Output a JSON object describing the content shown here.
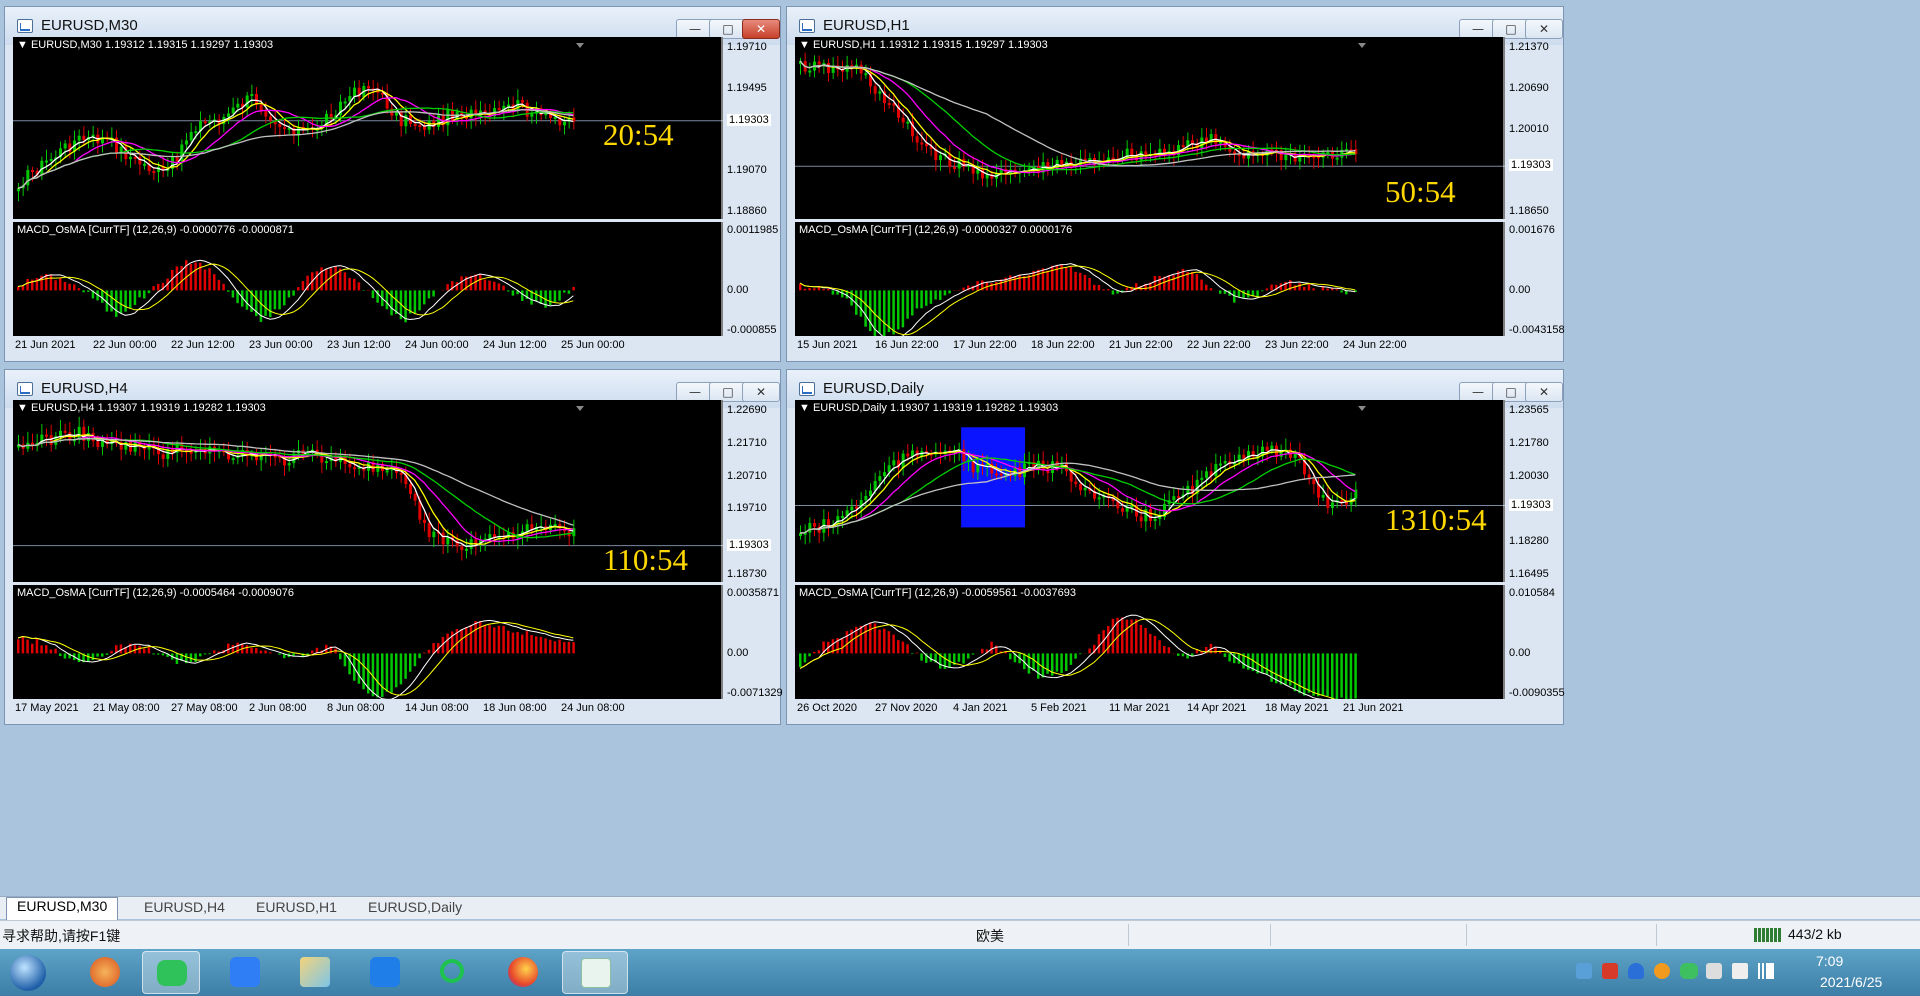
{
  "windows": [
    {
      "title": "EURUSD,M30",
      "symbol_line": "EURUSD,M30  1.19312 1.19315 1.19297 1.19303",
      "indicator_line": "MACD_OsMA [CurrTF] (12,26,9) -0.0000776 -0.0000871",
      "price_axis": [
        "1.19710",
        "1.19495",
        "1.19303",
        "1.19070",
        "1.18860"
      ],
      "ind_axis": [
        "0.0011985",
        "0.00",
        "-0.000855"
      ],
      "time_axis": [
        "21 Jun 2021",
        "22 Jun 00:00",
        "22 Jun 12:00",
        "23 Jun 00:00",
        "23 Jun 12:00",
        "24 Jun 00:00",
        "24 Jun 12:00",
        "25 Jun 00:00"
      ],
      "current_price": "1.19303",
      "countdown": "20:54"
    },
    {
      "title": "EURUSD,H1",
      "symbol_line": "EURUSD,H1  1.19312 1.19315 1.19297 1.19303",
      "indicator_line": "MACD_OsMA [CurrTF] (12,26,9) -0.0000327 0.0000176",
      "price_axis": [
        "1.21370",
        "1.20690",
        "1.20010",
        "1.19303",
        "1.18650"
      ],
      "ind_axis": [
        "0.001676",
        "0.00",
        "-0.0043158"
      ],
      "time_axis": [
        "15 Jun 2021",
        "16 Jun 22:00",
        "17 Jun 22:00",
        "18 Jun 22:00",
        "21 Jun 22:00",
        "22 Jun 22:00",
        "23 Jun 22:00",
        "24 Jun 22:00"
      ],
      "current_price": "1.19303",
      "countdown": "50:54"
    },
    {
      "title": "EURUSD,H4",
      "symbol_line": "EURUSD,H4  1.19307 1.19319 1.19282 1.19303",
      "indicator_line": "MACD_OsMA [CurrTF] (12,26,9) -0.0005464 -0.0009076",
      "price_axis": [
        "1.22690",
        "1.21710",
        "1.20710",
        "1.19710",
        "1.19303",
        "1.18730"
      ],
      "ind_axis": [
        "0.0035871",
        "0.00",
        "-0.0071329"
      ],
      "time_axis": [
        "17 May 2021",
        "21 May 08:00",
        "27 May 08:00",
        "2 Jun 08:00",
        "8 Jun 08:00",
        "14 Jun 08:00",
        "18 Jun 08:00",
        "24 Jun 08:00"
      ],
      "current_price": "1.19303",
      "countdown": "110:54"
    },
    {
      "title": "EURUSD,Daily",
      "symbol_line": "EURUSD,Daily  1.19307 1.19319 1.19282 1.19303",
      "indicator_line": "MACD_OsMA [CurrTF] (12,26,9) -0.0059561 -0.0037693",
      "price_axis": [
        "1.23565",
        "1.21780",
        "1.20030",
        "1.19303",
        "1.18280",
        "1.16495"
      ],
      "ind_axis": [
        "0.010584",
        "0.00",
        "-0.0090355"
      ],
      "time_axis": [
        "26 Oct 2020",
        "27 Nov 2020",
        "4 Jan 2021",
        "5 Feb 2021",
        "11 Mar 2021",
        "14 Apr 2021",
        "18 May 2021",
        "21 Jun 2021"
      ],
      "current_price": "1.19303",
      "countdown": "1310:54"
    }
  ],
  "tabs": [
    "EURUSD,M30",
    "EURUSD,H4",
    "EURUSD,H1",
    "EURUSD,Daily"
  ],
  "status": {
    "help": "寻求帮助,请按F1键",
    "profile": "欧美",
    "connection": "443/2 kb"
  },
  "taskbar": {
    "time": "7:09",
    "date": "2021/6/25"
  },
  "colors": {
    "bull": "#00c800",
    "bear": "#e00000",
    "ma_white": "#ffffff",
    "ma_yellow": "#ffff00",
    "ma_magenta": "#ff00ff",
    "ma_green": "#00d000",
    "ma_gray": "#c0c0c0",
    "countdown": "#ffd800"
  }
}
